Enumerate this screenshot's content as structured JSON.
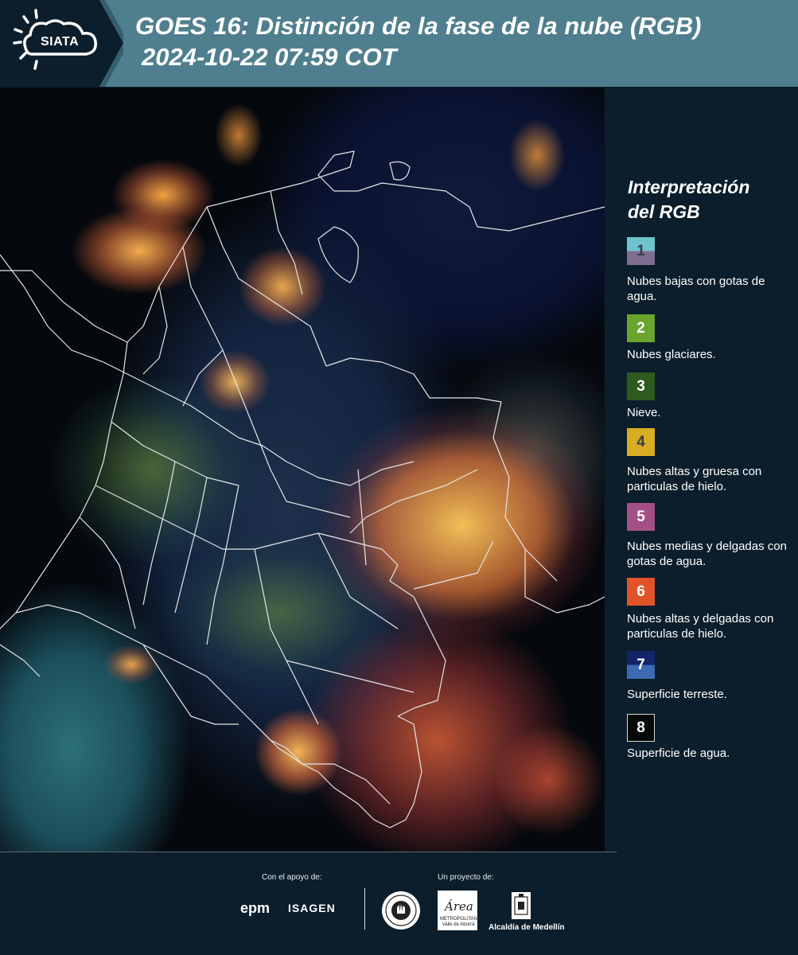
{
  "header": {
    "logo_text": "SIATA",
    "title": "GOES 16: Distinción de la fase de la nube (RGB)",
    "timestamp": "2024-10-22 07:59 COT"
  },
  "map": {
    "image_kind": "satellite RGB composite",
    "boundary_color": "#e6e6e6"
  },
  "legend": {
    "title_line1": "Interpretación",
    "title_line2": "del RGB",
    "items": [
      {
        "num": "1",
        "label": "Nubes bajas con gotas de agua.",
        "color_top": "#6ec3cd",
        "color_bottom": "#7e6f91",
        "num_color": "#3b3b4a"
      },
      {
        "num": "2",
        "label": "Nubes glaciares.",
        "color_top": "#6aa52e",
        "color_bottom": "#6aa52e",
        "num_color": "#ffffff"
      },
      {
        "num": "3",
        "label": "Nieve.",
        "color_top": "#2f5a1d",
        "color_bottom": "#2f5a1d",
        "num_color": "#ffffff"
      },
      {
        "num": "4",
        "label": "Nubes altas y gruesa con particulas de hielo.",
        "color_top": "#d8ad21",
        "color_bottom": "#d8ad21",
        "num_color": "#3b3b4a"
      },
      {
        "num": "5",
        "label": "Nubes medias y delgadas con gotas de agua.",
        "color_top": "#a44f86",
        "color_bottom": "#a44f86",
        "num_color": "#ffffff"
      },
      {
        "num": "6",
        "label": "Nubes altas y delgadas con particulas de hielo.",
        "color_top": "#e25428",
        "color_bottom": "#e25428",
        "num_color": "#ffffff"
      },
      {
        "num": "7",
        "label": "Superficie terreste.",
        "color_top": "#12256b",
        "color_bottom": "#3d6ab3",
        "num_color": "#ffffff"
      },
      {
        "num": "8",
        "label": "Superficie de agua.",
        "color_top": "#050a06",
        "color_bottom": "#050a06",
        "num_color": "#ffffff"
      }
    ]
  },
  "footer": {
    "support_caption": "Con el apoyo de:",
    "project_caption": "Un proyecto de:",
    "epm": "epm",
    "isagen": "ISAGEN",
    "area_word": "Área",
    "area_text": "METROPOLITANA Valle de Aburrá",
    "medellin": "Alcaldía de Medellín"
  }
}
